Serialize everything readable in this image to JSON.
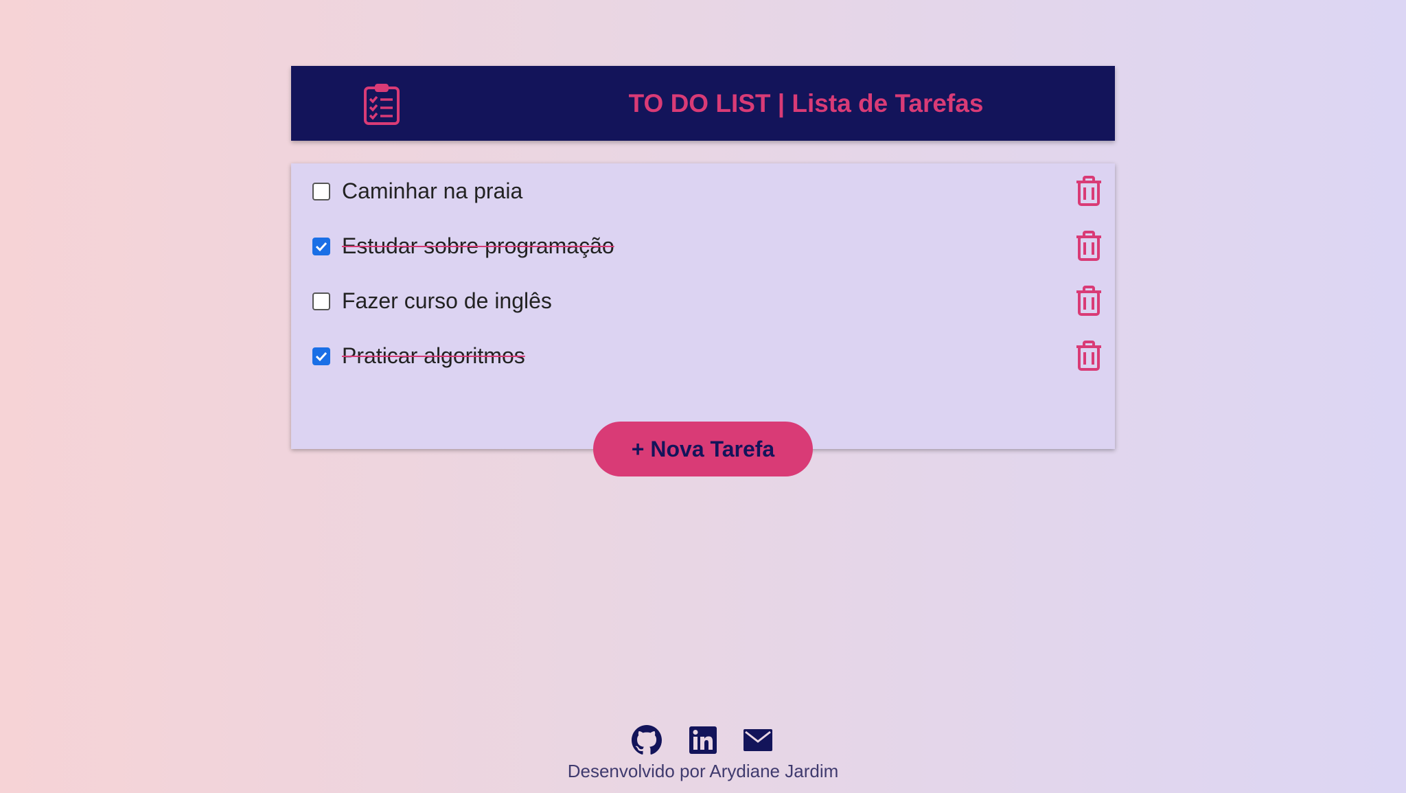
{
  "header": {
    "title": "TO DO LIST | Lista de Tarefas",
    "logo_icon": "clipboard-list-icon"
  },
  "tasks": [
    {
      "label": "Caminhar na praia",
      "done": false
    },
    {
      "label": "Estudar sobre programação",
      "done": true
    },
    {
      "label": "Fazer curso de inglês",
      "done": false
    },
    {
      "label": "Praticar algoritmos",
      "done": true
    }
  ],
  "add_button": {
    "label": "+ Nova Tarefa"
  },
  "footer": {
    "icons": [
      "github-icon",
      "linkedin-icon",
      "mail-icon"
    ],
    "credit": "Desenvolvido por Arydiane Jardim"
  },
  "colors": {
    "accent": "#d93b76",
    "navy": "#13145a",
    "card": "#dcd3f2",
    "checkbox": "#1a6fe6"
  }
}
